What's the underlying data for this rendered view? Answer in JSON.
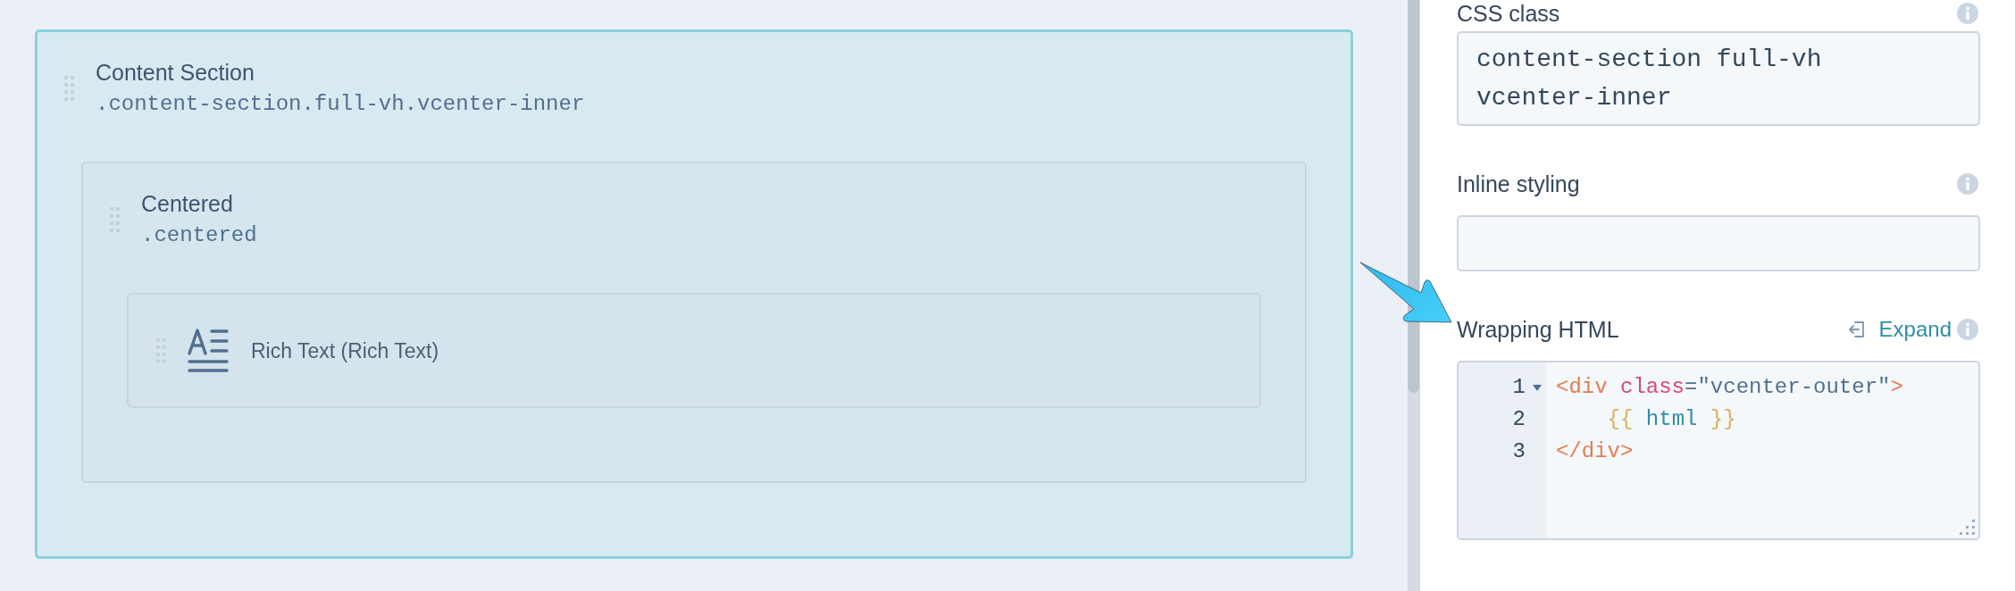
{
  "canvas": {
    "nodes": [
      {
        "kind": "section",
        "title": "Content Section",
        "selector": ".content-section.full-vh.vcenter-inner",
        "selected": true,
        "children": [
          {
            "kind": "section",
            "title": "Centered",
            "selector": ".centered",
            "selected": false,
            "children": [
              {
                "kind": "module",
                "title": "Rich Text (Rich Text)",
                "selected": false
              }
            ]
          }
        ]
      }
    ]
  },
  "inspector": {
    "fields": [
      {
        "kind": "text",
        "label": "CSS class",
        "value": "content-section full-vh vcenter-inner"
      },
      {
        "kind": "text",
        "label": "Inline styling"
      },
      {
        "kind": "code",
        "label": "Wrapping HTML",
        "action": "Expand",
        "lines": [
          {
            "number": "1",
            "foldable": true,
            "tokens": [
              {
                "kind": "tag",
                "text": "<div"
              },
              {
                "kind": "attr",
                "text": " class"
              },
              {
                "kind": "plain",
                "text": "=\"vcenter-outer\""
              },
              {
                "kind": "tag",
                "text": ">"
              }
            ]
          },
          {
            "number": "2",
            "foldable": false,
            "tokens": [
              {
                "kind": "brace",
                "text": "    {{"
              },
              {
                "kind": "var",
                "text": " html "
              },
              {
                "kind": "brace",
                "text": "}}"
              }
            ]
          },
          {
            "number": "3",
            "foldable": false,
            "tokens": [
              {
                "kind": "tag",
                "text": "</div>"
              }
            ]
          }
        ]
      }
    ]
  }
}
